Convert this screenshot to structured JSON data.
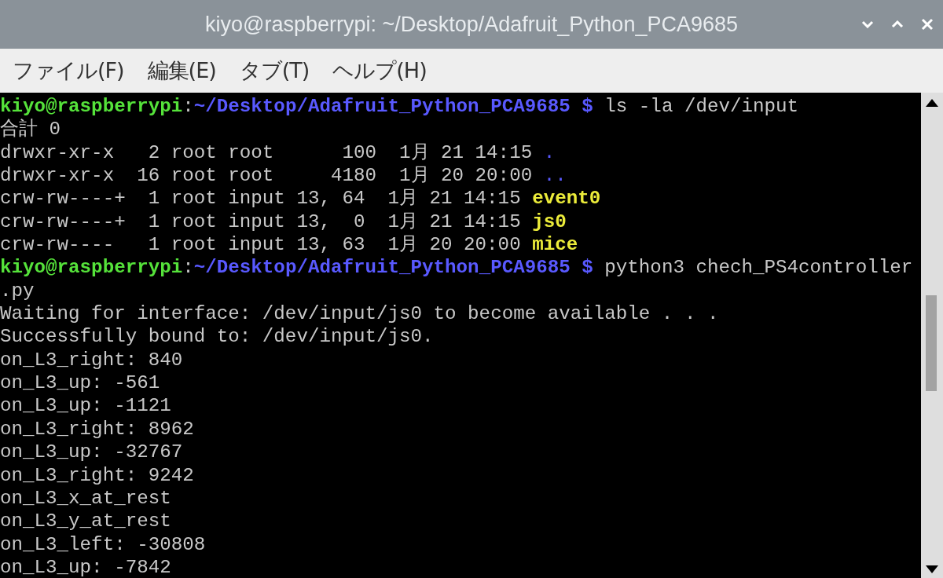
{
  "window": {
    "title": "kiyo@raspberrypi: ~/Desktop/Adafruit_Python_PCA9685"
  },
  "menu": [
    {
      "label": "ファイル(F)"
    },
    {
      "label": "編集(E)"
    },
    {
      "label": "タブ(T)"
    },
    {
      "label": "ヘルプ(H)"
    }
  ],
  "terminal": {
    "lines": [
      {
        "segments": [
          {
            "kind": "user",
            "text": "kiyo@raspberrypi"
          },
          {
            "kind": "plain",
            "text": ":"
          },
          {
            "kind": "path",
            "text": "~/Desktop/Adafruit_Python_PCA9685 $"
          },
          {
            "kind": "plain",
            "text": " ls -la /dev/input"
          }
        ]
      },
      {
        "segments": [
          {
            "kind": "plain",
            "text": "合計 0"
          }
        ]
      },
      {
        "segments": [
          {
            "kind": "plain",
            "text": "drwxr-xr-x   2 root root      100  1月 21 14:15 "
          },
          {
            "kind": "dir",
            "text": "."
          }
        ]
      },
      {
        "segments": [
          {
            "kind": "plain",
            "text": "drwxr-xr-x  16 root root     4180  1月 20 20:00 "
          },
          {
            "kind": "dir",
            "text": ".."
          }
        ]
      },
      {
        "segments": [
          {
            "kind": "plain",
            "text": "crw-rw----+  1 root input 13, 64  1月 21 14:15 "
          },
          {
            "kind": "device",
            "text": "event0"
          }
        ]
      },
      {
        "segments": [
          {
            "kind": "plain",
            "text": "crw-rw----+  1 root input 13,  0  1月 21 14:15 "
          },
          {
            "kind": "device",
            "text": "js0"
          }
        ]
      },
      {
        "segments": [
          {
            "kind": "plain",
            "text": "crw-rw----   1 root input 13, 63  1月 20 20:00 "
          },
          {
            "kind": "device",
            "text": "mice"
          }
        ]
      },
      {
        "segments": [
          {
            "kind": "user",
            "text": "kiyo@raspberrypi"
          },
          {
            "kind": "plain",
            "text": ":"
          },
          {
            "kind": "path",
            "text": "~/Desktop/Adafruit_Python_PCA9685 $"
          },
          {
            "kind": "plain",
            "text": " python3 chech_PS4controller"
          }
        ]
      },
      {
        "segments": [
          {
            "kind": "plain",
            "text": ".py"
          }
        ]
      },
      {
        "segments": [
          {
            "kind": "plain",
            "text": "Waiting for interface: /dev/input/js0 to become available . . ."
          }
        ]
      },
      {
        "segments": [
          {
            "kind": "plain",
            "text": "Successfully bound to: /dev/input/js0."
          }
        ]
      },
      {
        "segments": [
          {
            "kind": "plain",
            "text": "on_L3_right: 840"
          }
        ]
      },
      {
        "segments": [
          {
            "kind": "plain",
            "text": "on_L3_up: -561"
          }
        ]
      },
      {
        "segments": [
          {
            "kind": "plain",
            "text": "on_L3_up: -1121"
          }
        ]
      },
      {
        "segments": [
          {
            "kind": "plain",
            "text": "on_L3_right: 8962"
          }
        ]
      },
      {
        "segments": [
          {
            "kind": "plain",
            "text": "on_L3_up: -32767"
          }
        ]
      },
      {
        "segments": [
          {
            "kind": "plain",
            "text": "on_L3_right: 9242"
          }
        ]
      },
      {
        "segments": [
          {
            "kind": "plain",
            "text": "on_L3_x_at_rest"
          }
        ]
      },
      {
        "segments": [
          {
            "kind": "plain",
            "text": "on_L3_y_at_rest"
          }
        ]
      },
      {
        "segments": [
          {
            "kind": "plain",
            "text": "on_L3_left: -30808"
          }
        ]
      },
      {
        "segments": [
          {
            "kind": "plain",
            "text": "on_L3_up: -7842"
          }
        ]
      }
    ]
  }
}
